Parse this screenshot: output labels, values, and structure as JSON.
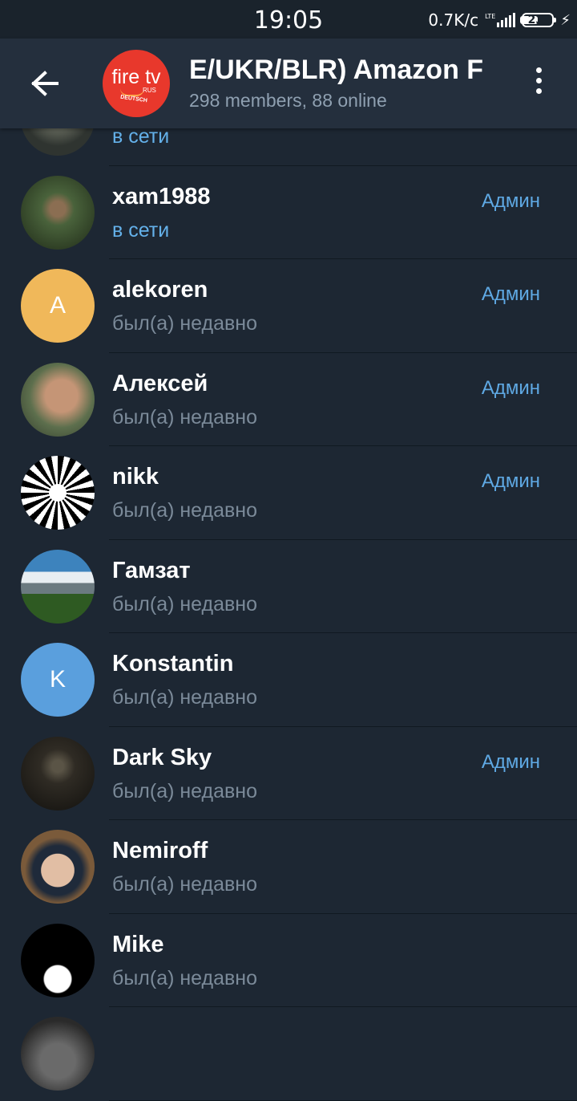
{
  "status_bar": {
    "time": "19:05",
    "network_speed": "0.7K/c",
    "network_type": "LTE",
    "battery": "23"
  },
  "header": {
    "title": "E/UKR/BLR)    Amazon F",
    "subtitle": "298 members, 88 online",
    "avatar": {
      "brand": "fire tv",
      "line1": "RUS",
      "line2": "DEUTSCH"
    }
  },
  "members": [
    {
      "name": "",
      "status": "в сети",
      "online": true,
      "badge": "",
      "avatar_color": "#3a3f3a",
      "letter": ""
    },
    {
      "name": "xam1988",
      "status": "в сети",
      "online": true,
      "badge": "Админ",
      "avatar_color": "#4a6a34",
      "letter": ""
    },
    {
      "name": "alekoren",
      "status": "был(а) недавно",
      "online": false,
      "badge": "Админ",
      "avatar_color": "#f0b85a",
      "letter": "A"
    },
    {
      "name": "Алексей",
      "status": "был(а) недавно",
      "online": false,
      "badge": "Админ",
      "avatar_color": "#6f7e58",
      "letter": ""
    },
    {
      "name": "nikk",
      "status": "был(а) недавно",
      "online": false,
      "badge": "Админ",
      "avatar_color": "#ffffff",
      "letter": ""
    },
    {
      "name": "Гамзат",
      "status": "был(а) недавно",
      "online": false,
      "badge": "",
      "avatar_color": "#5a8fb6",
      "letter": ""
    },
    {
      "name": "Konstantin",
      "status": "был(а) недавно",
      "online": false,
      "badge": "",
      "avatar_color": "#5a9fdd",
      "letter": "K"
    },
    {
      "name": "Dark Sky",
      "status": "был(а) недавно",
      "online": false,
      "badge": "Админ",
      "avatar_color": "#2d2a24",
      "letter": ""
    },
    {
      "name": "Nemiroff",
      "status": "был(а) недавно",
      "online": false,
      "badge": "",
      "avatar_color": "#9a7c62",
      "letter": ""
    },
    {
      "name": "Mike",
      "status": "был(а) недавно",
      "online": false,
      "badge": "",
      "avatar_color": "#000000",
      "letter": ""
    },
    {
      "name": "",
      "status": "",
      "online": false,
      "badge": "",
      "avatar_color": "#4a4a4a",
      "letter": ""
    }
  ],
  "icons": {
    "back": "arrow-left-icon",
    "menu": "more-vertical-icon"
  }
}
